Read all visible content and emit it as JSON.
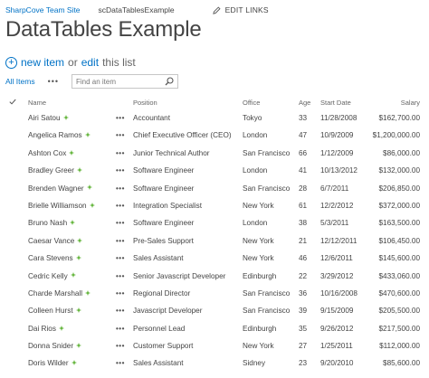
{
  "topnav": {
    "site": "SharpCove Team Site",
    "page": "scDataTablesExample",
    "edit_links": "EDIT LINKS"
  },
  "page_title": "DataTables Example",
  "command_bar": {
    "new_item": "new item",
    "or": "or",
    "edit": "edit",
    "this_list": "this list"
  },
  "view_bar": {
    "all_items": "All Items",
    "more": "•••",
    "search_placeholder": "Find an item"
  },
  "columns": {
    "name": "Name",
    "position": "Position",
    "office": "Office",
    "age": "Age",
    "start_date": "Start Date",
    "salary": "Salary"
  },
  "row_menu": "•••",
  "rows": [
    {
      "name": "Airi Satou",
      "position": "Accountant",
      "office": "Tokyo",
      "age": "33",
      "start": "11/28/2008",
      "salary": "$162,700.00"
    },
    {
      "name": "Angelica Ramos",
      "position": "Chief Executive Officer (CEO)",
      "office": "London",
      "age": "47",
      "start": "10/9/2009",
      "salary": "$1,200,000.00"
    },
    {
      "name": "Ashton Cox",
      "position": "Junior Technical Author",
      "office": "San Francisco",
      "age": "66",
      "start": "1/12/2009",
      "salary": "$86,000.00"
    },
    {
      "name": "Bradley Greer",
      "position": "Software Engineer",
      "office": "London",
      "age": "41",
      "start": "10/13/2012",
      "salary": "$132,000.00"
    },
    {
      "name": "Brenden Wagner",
      "position": "Software Engineer",
      "office": "San Francisco",
      "age": "28",
      "start": "6/7/2011",
      "salary": "$206,850.00"
    },
    {
      "name": "Brielle Williamson",
      "position": "Integration Specialist",
      "office": "New York",
      "age": "61",
      "start": "12/2/2012",
      "salary": "$372,000.00"
    },
    {
      "name": "Bruno Nash",
      "position": "Software Engineer",
      "office": "London",
      "age": "38",
      "start": "5/3/2011",
      "salary": "$163,500.00"
    },
    {
      "name": "Caesar Vance",
      "position": "Pre-Sales Support",
      "office": "New York",
      "age": "21",
      "start": "12/12/2011",
      "salary": "$106,450.00"
    },
    {
      "name": "Cara Stevens",
      "position": "Sales Assistant",
      "office": "New York",
      "age": "46",
      "start": "12/6/2011",
      "salary": "$145,600.00"
    },
    {
      "name": "Cedric Kelly",
      "position": "Senior Javascript Developer",
      "office": "Edinburgh",
      "age": "22",
      "start": "3/29/2012",
      "salary": "$433,060.00"
    },
    {
      "name": "Charde Marshall",
      "position": "Regional Director",
      "office": "San Francisco",
      "age": "36",
      "start": "10/16/2008",
      "salary": "$470,600.00"
    },
    {
      "name": "Colleen Hurst",
      "position": "Javascript Developer",
      "office": "San Francisco",
      "age": "39",
      "start": "9/15/2009",
      "salary": "$205,500.00"
    },
    {
      "name": "Dai Rios",
      "position": "Personnel Lead",
      "office": "Edinburgh",
      "age": "35",
      "start": "9/26/2012",
      "salary": "$217,500.00"
    },
    {
      "name": "Donna Snider",
      "position": "Customer Support",
      "office": "New York",
      "age": "27",
      "start": "1/25/2011",
      "salary": "$112,000.00"
    },
    {
      "name": "Doris Wilder",
      "position": "Sales Assistant",
      "office": "Sidney",
      "age": "23",
      "start": "9/20/2010",
      "salary": "$85,600.00"
    }
  ],
  "colors": {
    "accent": "#0072c6",
    "new_badge": "#5fb336",
    "text": "#444444"
  }
}
